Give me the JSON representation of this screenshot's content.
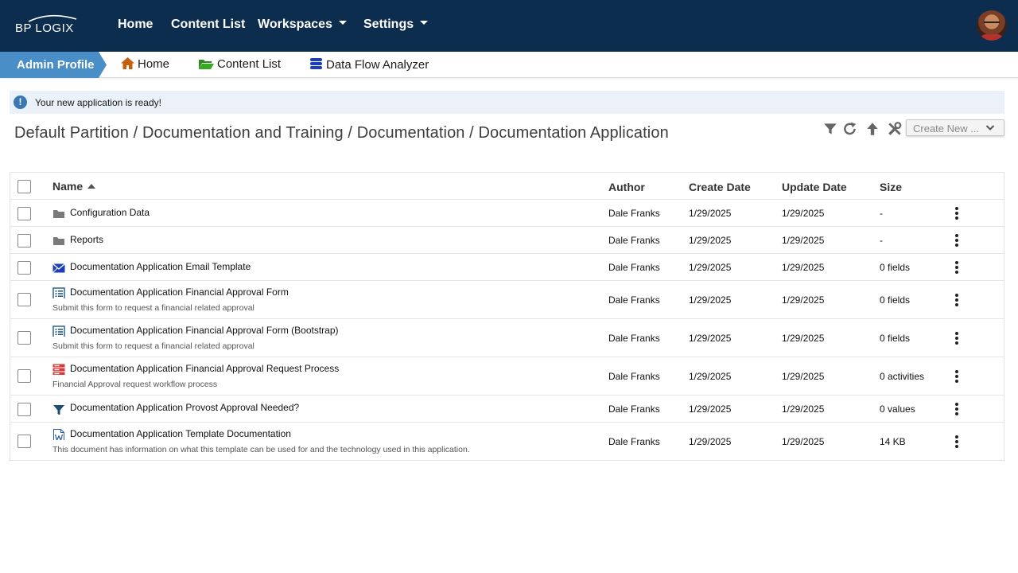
{
  "header": {
    "logo_text": "BP LOGIX",
    "nav": [
      {
        "label": "Home"
      },
      {
        "label": "Content List"
      },
      {
        "label": "Workspaces"
      },
      {
        "label": "Settings"
      }
    ]
  },
  "subnav": {
    "profile_label": "Admin Profile",
    "items": [
      {
        "label": "Home",
        "icon": "home-icon"
      },
      {
        "label": "Content List",
        "icon": "folder-open-icon"
      },
      {
        "label": "Data Flow Analyzer",
        "icon": "database-icon"
      }
    ]
  },
  "banner": {
    "text": "Your new application is ready!",
    "icon": "info-icon"
  },
  "breadcrumb": "Default Partition / Documentation and Training / Documentation / Documentation Application",
  "toolbar": {
    "tools": [
      "filter-icon",
      "refresh-icon",
      "upload-icon",
      "tools-icon"
    ],
    "create_label": "Create New ..."
  },
  "table": {
    "columns": {
      "name": "Name",
      "author": "Author",
      "create": "Create Date",
      "update": "Update Date",
      "size": "Size"
    },
    "rows": [
      {
        "icon": "folder-icon",
        "name": "Configuration Data",
        "desc": "",
        "author": "Dale Franks",
        "create": "1/29/2025",
        "update": "1/29/2025",
        "size": "-"
      },
      {
        "icon": "folder-icon",
        "name": "Reports",
        "desc": "",
        "author": "Dale Franks",
        "create": "1/29/2025",
        "update": "1/29/2025",
        "size": "-"
      },
      {
        "icon": "email-template-icon",
        "name": "Documentation Application Email Template",
        "desc": "",
        "author": "Dale Franks",
        "create": "1/29/2025",
        "update": "1/29/2025",
        "size": "0 fields"
      },
      {
        "icon": "form-icon",
        "name": "Documentation Application Financial Approval Form",
        "desc": "Submit this form to request a financial related approval",
        "author": "Dale Franks",
        "create": "1/29/2025",
        "update": "1/29/2025",
        "size": "0 fields"
      },
      {
        "icon": "form-icon",
        "name": "Documentation Application Financial Approval Form (Bootstrap)",
        "desc": "Submit this form to request a financial related approval",
        "author": "Dale Franks",
        "create": "1/29/2025",
        "update": "1/29/2025",
        "size": "0 fields"
      },
      {
        "icon": "process-icon",
        "name": "Documentation Application Financial Approval Request Process",
        "desc": "Financial Approval request workflow process",
        "author": "Dale Franks",
        "create": "1/29/2025",
        "update": "1/29/2025",
        "size": "0 activities"
      },
      {
        "icon": "rule-filter-icon",
        "name": "Documentation Application Provost Approval Needed?",
        "desc": "",
        "author": "Dale Franks",
        "create": "1/29/2025",
        "update": "1/29/2025",
        "size": "0 values"
      },
      {
        "icon": "word-document-icon",
        "name": "Documentation Application Template Documentation",
        "desc": "This document has information on what this template can be used for and the technology used in this application.",
        "author": "Dale Franks",
        "create": "1/29/2025",
        "update": "1/29/2025",
        "size": "14 KB"
      }
    ]
  },
  "colors": {
    "topbar": "#0d2d4f",
    "profile_tab": "#4a8ec7",
    "banner_bg": "#eaf1f8",
    "info": "#3a78b5"
  }
}
